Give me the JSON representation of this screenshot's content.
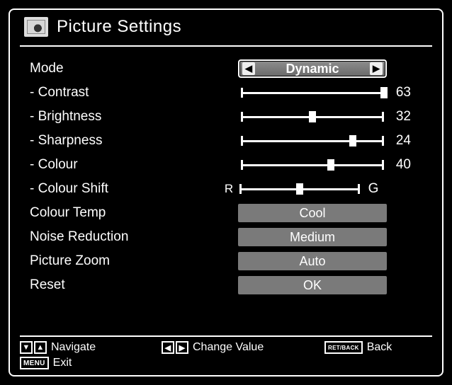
{
  "title": "Picture Settings",
  "mode": {
    "label": "Mode",
    "value": "Dynamic"
  },
  "sliders": {
    "contrast": {
      "label": "- Contrast",
      "value": 63,
      "pct": 100
    },
    "brightness": {
      "label": "- Brightness",
      "value": 32,
      "pct": 50
    },
    "sharpness": {
      "label": "- Sharpness",
      "value": 24,
      "pct": 78
    },
    "colour": {
      "label": "- Colour",
      "value": 40,
      "pct": 63
    },
    "shift": {
      "label": "- Colour Shift",
      "left": "R",
      "right": "G",
      "pct": 50
    }
  },
  "options": {
    "temp": {
      "label": "Colour Temp",
      "value": "Cool"
    },
    "noise": {
      "label": "Noise Reduction",
      "value": "Medium"
    },
    "zoom": {
      "label": "Picture Zoom",
      "value": "Auto"
    },
    "reset": {
      "label": "Reset",
      "value": "OK"
    }
  },
  "footer": {
    "navigate": "Navigate",
    "change": "Change Value",
    "back_key": "RET/BACK",
    "back": "Back",
    "menu_key": "MENU",
    "exit": "Exit"
  }
}
